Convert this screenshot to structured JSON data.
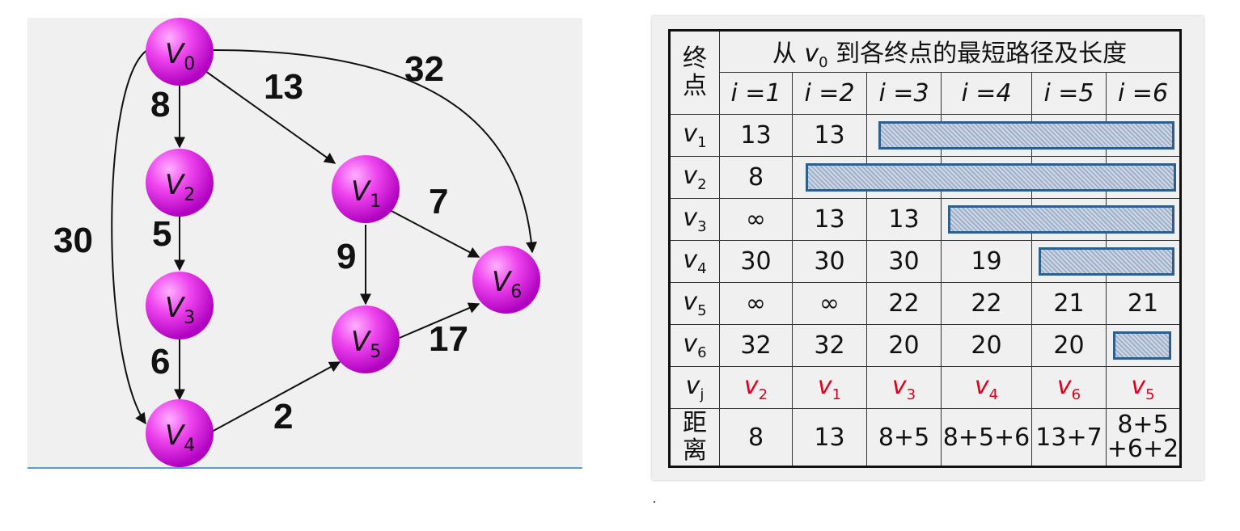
{
  "graph": {
    "nodes": [
      {
        "id": "v0",
        "name": "V",
        "sub": "0"
      },
      {
        "id": "v1",
        "name": "V",
        "sub": "1"
      },
      {
        "id": "v2",
        "name": "V",
        "sub": "2"
      },
      {
        "id": "v3",
        "name": "V",
        "sub": "3"
      },
      {
        "id": "v4",
        "name": "V",
        "sub": "4"
      },
      {
        "id": "v5",
        "name": "V",
        "sub": "5"
      },
      {
        "id": "v6",
        "name": "V",
        "sub": "6"
      }
    ],
    "edges": [
      {
        "from": "v0",
        "to": "v2",
        "weight": "8"
      },
      {
        "from": "v0",
        "to": "v1",
        "weight": "13"
      },
      {
        "from": "v0",
        "to": "v6",
        "weight": "32"
      },
      {
        "from": "v0",
        "to": "v4",
        "weight": "30"
      },
      {
        "from": "v2",
        "to": "v3",
        "weight": "5"
      },
      {
        "from": "v3",
        "to": "v4",
        "weight": "6"
      },
      {
        "from": "v1",
        "to": "v6",
        "weight": "7"
      },
      {
        "from": "v1",
        "to": "v5",
        "weight": "9"
      },
      {
        "from": "v5",
        "to": "v6",
        "weight": "17"
      },
      {
        "from": "v4",
        "to": "v5",
        "weight": "2"
      }
    ],
    "colors": {
      "node_fill": "#e040e0",
      "node_edge": "#b000b0",
      "background": "#f0f0f0"
    }
  },
  "table": {
    "corner_line1": "终",
    "corner_line2": "点",
    "title_prefix": "从 ",
    "title_v": "v",
    "title_sub": "0",
    "title_suffix": " 到各终点的最短路径及长度",
    "iterations": [
      "i =1",
      "i =2",
      "i =3",
      "i =4",
      "i =5",
      "i =6"
    ],
    "rows": [
      {
        "v": "v",
        "sub": "1",
        "cells": [
          "13",
          "13",
          "",
          "",
          "",
          ""
        ]
      },
      {
        "v": "v",
        "sub": "2",
        "cells": [
          "8",
          "",
          "",
          "",
          "",
          ""
        ]
      },
      {
        "v": "v",
        "sub": "3",
        "cells": [
          "∞",
          "13",
          "13",
          "",
          "",
          ""
        ]
      },
      {
        "v": "v",
        "sub": "4",
        "cells": [
          "30",
          "30",
          "30",
          "19",
          "",
          ""
        ]
      },
      {
        "v": "v",
        "sub": "5",
        "cells": [
          "∞",
          "∞",
          "22",
          "22",
          "21",
          "21"
        ]
      },
      {
        "v": "v",
        "sub": "6",
        "cells": [
          "32",
          "32",
          "20",
          "20",
          "20",
          ""
        ]
      }
    ],
    "vj_label": "v",
    "vj_sub": "j",
    "vj_row": [
      {
        "v": "v",
        "sub": "2"
      },
      {
        "v": "v",
        "sub": "1"
      },
      {
        "v": "v",
        "sub": "3"
      },
      {
        "v": "v",
        "sub": "4"
      },
      {
        "v": "v",
        "sub": "6"
      },
      {
        "v": "v",
        "sub": "5"
      }
    ],
    "dist_line1": "距",
    "dist_line2": "离",
    "dist_row": [
      "8",
      "13",
      "8+5",
      "8+5+6",
      "13+7",
      "8+5"
    ],
    "dist_row_extra": "+6+2",
    "colors": {
      "selected": "#e0001b",
      "hatch_border": "#2e5f8a"
    }
  }
}
